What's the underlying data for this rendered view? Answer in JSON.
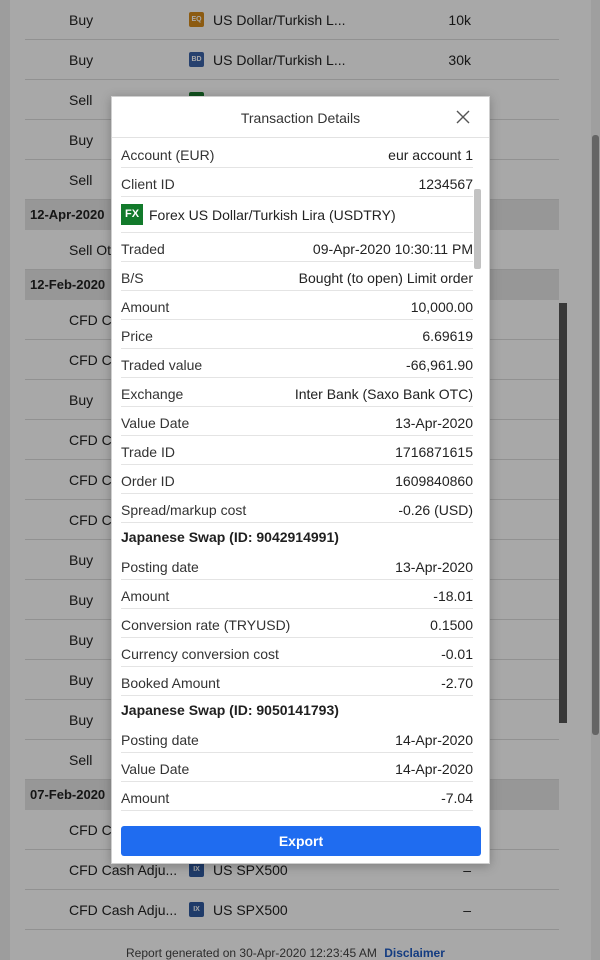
{
  "report": {
    "rows": [
      {
        "kind": "row",
        "type": "Buy",
        "icon": "EQ",
        "icon_color": "#d58a1a",
        "instrument": "US Dollar/Turkish L...",
        "qty": "10k"
      },
      {
        "kind": "row",
        "type": "Buy",
        "icon": "BD",
        "icon_color": "#3c63a8",
        "instrument": "US Dollar/Turkish L...",
        "qty": "30k"
      },
      {
        "kind": "row",
        "type": "Sell",
        "icon": "",
        "icon_color": "#1a7a2e",
        "instrument": "",
        "qty": ""
      },
      {
        "kind": "row",
        "type": "Buy",
        "icon": "",
        "icon_color": "",
        "instrument": "",
        "qty": ""
      },
      {
        "kind": "row",
        "type": "Sell",
        "icon": "",
        "icon_color": "",
        "instrument": "",
        "qty": ""
      },
      {
        "kind": "date",
        "label": "12-Apr-2020"
      },
      {
        "kind": "row",
        "type": "Sell Ot",
        "icon": "",
        "icon_color": "",
        "instrument": "",
        "qty": ""
      },
      {
        "kind": "date",
        "label": "12-Feb-2020"
      },
      {
        "kind": "row",
        "type": "CFD C",
        "icon": "",
        "icon_color": "",
        "instrument": "",
        "qty": ""
      },
      {
        "kind": "row",
        "type": "CFD C",
        "icon": "",
        "icon_color": "",
        "instrument": "",
        "qty": ""
      },
      {
        "kind": "row",
        "type": "Buy",
        "icon": "",
        "icon_color": "",
        "instrument": "",
        "qty": ""
      },
      {
        "kind": "row",
        "type": "CFD C",
        "icon": "",
        "icon_color": "",
        "instrument": "",
        "qty": ""
      },
      {
        "kind": "row",
        "type": "CFD C",
        "icon": "",
        "icon_color": "",
        "instrument": "",
        "qty": ""
      },
      {
        "kind": "row",
        "type": "CFD C",
        "icon": "",
        "icon_color": "",
        "instrument": "",
        "qty": ""
      },
      {
        "kind": "row",
        "type": "Buy",
        "icon": "",
        "icon_color": "",
        "instrument": "",
        "qty": ""
      },
      {
        "kind": "row",
        "type": "Buy",
        "icon": "",
        "icon_color": "",
        "instrument": "",
        "qty": ""
      },
      {
        "kind": "row",
        "type": "Buy",
        "icon": "",
        "icon_color": "",
        "instrument": "",
        "qty": ""
      },
      {
        "kind": "row",
        "type": "Buy",
        "icon": "",
        "icon_color": "",
        "instrument": "",
        "qty": ""
      },
      {
        "kind": "row",
        "type": "Buy",
        "icon": "",
        "icon_color": "",
        "instrument": "",
        "qty": ""
      },
      {
        "kind": "row",
        "type": "Sell",
        "icon": "",
        "icon_color": "",
        "instrument": "",
        "qty": ""
      },
      {
        "kind": "date",
        "label": "07-Feb-2020"
      },
      {
        "kind": "row",
        "type": "CFD C",
        "icon": "",
        "icon_color": "",
        "instrument": "",
        "qty": ""
      },
      {
        "kind": "row",
        "type": "CFD Cash Adju...",
        "icon": "IX",
        "icon_color": "#2f5aa0",
        "instrument": "US SPX500",
        "qty": "–"
      },
      {
        "kind": "row",
        "type": "CFD Cash Adju...",
        "icon": "IX",
        "icon_color": "#2f5aa0",
        "instrument": "US SPX500",
        "qty": "–"
      }
    ],
    "footer_text": "Report generated on 30-Apr-2020 12:23:45 AM",
    "disclaimer": "Disclaimer"
  },
  "modal": {
    "title": "Transaction Details",
    "close_icon": "close-icon",
    "top_rows": [
      {
        "label": "Account (EUR)",
        "value": "eur account 1"
      },
      {
        "label": "Client ID",
        "value": "1234567"
      }
    ],
    "instrument": {
      "badge": "FX",
      "badge_color": "#127a2b",
      "name": "Forex US Dollar/Turkish Lira (USDTRY)"
    },
    "trade_rows": [
      {
        "label": "Traded",
        "value": "09-Apr-2020 10:30:11 PM"
      },
      {
        "label": "B/S",
        "value": "Bought (to open) Limit order"
      },
      {
        "label": "Amount",
        "value": "10,000.00"
      },
      {
        "label": "Price",
        "value": "6.69619"
      },
      {
        "label": "Traded value",
        "value": "-66,961.90"
      },
      {
        "label": "Exchange",
        "value": "Inter Bank (Saxo Bank OTC)"
      },
      {
        "label": "Value Date",
        "value": "13-Apr-2020"
      },
      {
        "label": "Trade ID",
        "value": "1716871615"
      },
      {
        "label": "Order ID",
        "value": "1609840860"
      },
      {
        "label": "Spread/markup cost",
        "value": "-0.26 (USD)"
      }
    ],
    "swap1": {
      "heading": "Japanese Swap (ID: 9042914991)",
      "rows": [
        {
          "label": "Posting date",
          "value": "13-Apr-2020"
        },
        {
          "label": "Amount",
          "value": "-18.01"
        },
        {
          "label": "Conversion rate (TRYUSD)",
          "value": "0.1500"
        },
        {
          "label": "Currency conversion cost",
          "value": "-0.01"
        },
        {
          "label": "Booked Amount",
          "value": "-2.70"
        }
      ]
    },
    "swap2": {
      "heading": "Japanese Swap (ID: 9050141793)",
      "rows": [
        {
          "label": "Posting date",
          "value": "14-Apr-2020"
        },
        {
          "label": "Value Date",
          "value": "14-Apr-2020"
        },
        {
          "label": "Amount",
          "value": "-7.04"
        }
      ]
    },
    "export_label": "Export",
    "accent_color": "#1f6cf0"
  }
}
